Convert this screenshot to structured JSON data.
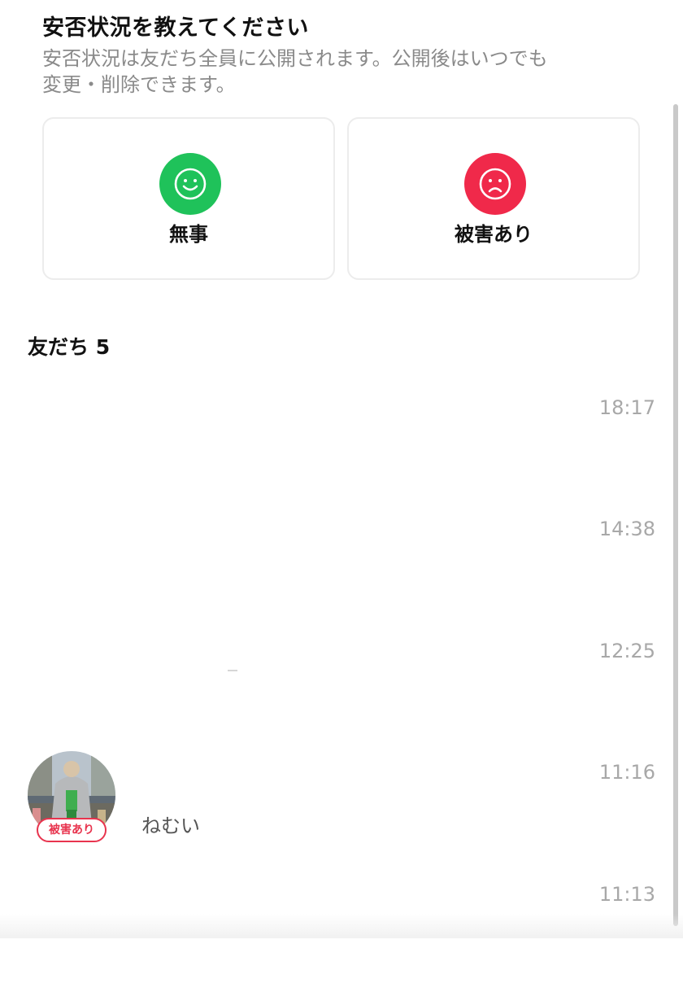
{
  "prompt": {
    "title": "安否状況を教えてください",
    "description_line1": "安否状況は友だち全員に公開されます。公開後はいつでも",
    "description_line2": "変更・削除できます。"
  },
  "status_options": [
    {
      "label": "無事",
      "icon": "smile-face-icon",
      "color": "#1fc25a"
    },
    {
      "label": "被害あり",
      "icon": "sad-face-icon",
      "color": "#f0294a"
    }
  ],
  "friends": {
    "heading": "友だち 5",
    "items": [
      {
        "time": "18:17",
        "message": "",
        "badge": ""
      },
      {
        "time": "14:38",
        "message": "",
        "badge": ""
      },
      {
        "time": "12:25",
        "message": "",
        "badge": ""
      },
      {
        "time": "11:16",
        "message": "ねむい",
        "badge": "被害あり"
      },
      {
        "time": "11:13",
        "message": "",
        "badge": ""
      }
    ]
  }
}
